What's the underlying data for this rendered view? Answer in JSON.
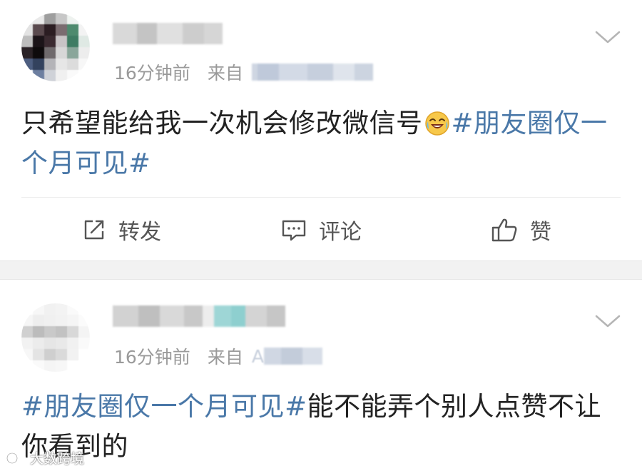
{
  "posts": [
    {
      "time": "16分钟前",
      "from_label": "来自",
      "body_text": "只希望能给我一次机会修改微信号",
      "emoji_icon": "laughing-tears-emoji-icon",
      "hashtag": "#朋友圈仅一个月可见#",
      "actions": {
        "repost": "转发",
        "comment": "评论",
        "like": "赞"
      }
    },
    {
      "time": "16分钟前",
      "from_label": "来自",
      "source_visible": "A",
      "hashtag": "#朋友圈仅一个月可见#",
      "body_text": "能不能弄个别人点赞不让你看到的"
    }
  ],
  "watermark": {
    "text": "大数跨境",
    "icon": "brand-logo-icon"
  },
  "colors": {
    "hashtag": "#4a78a8",
    "meta": "#9a9a9a",
    "body": "#222222",
    "separator": "#f2f2f2"
  }
}
